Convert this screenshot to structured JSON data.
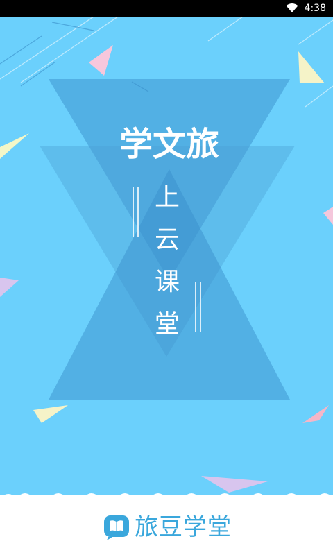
{
  "status_bar": {
    "time": "4:38",
    "wifi_icon": "wifi-icon"
  },
  "splash": {
    "title": "学文旅",
    "subtitle_chars": [
      "上",
      "云",
      "课",
      "堂"
    ],
    "background_color": "#6bd0fc"
  },
  "footer": {
    "brand_icon": "book-bubble-icon",
    "brand_name": "旅豆学堂",
    "brand_color": "#3aa7dc"
  }
}
